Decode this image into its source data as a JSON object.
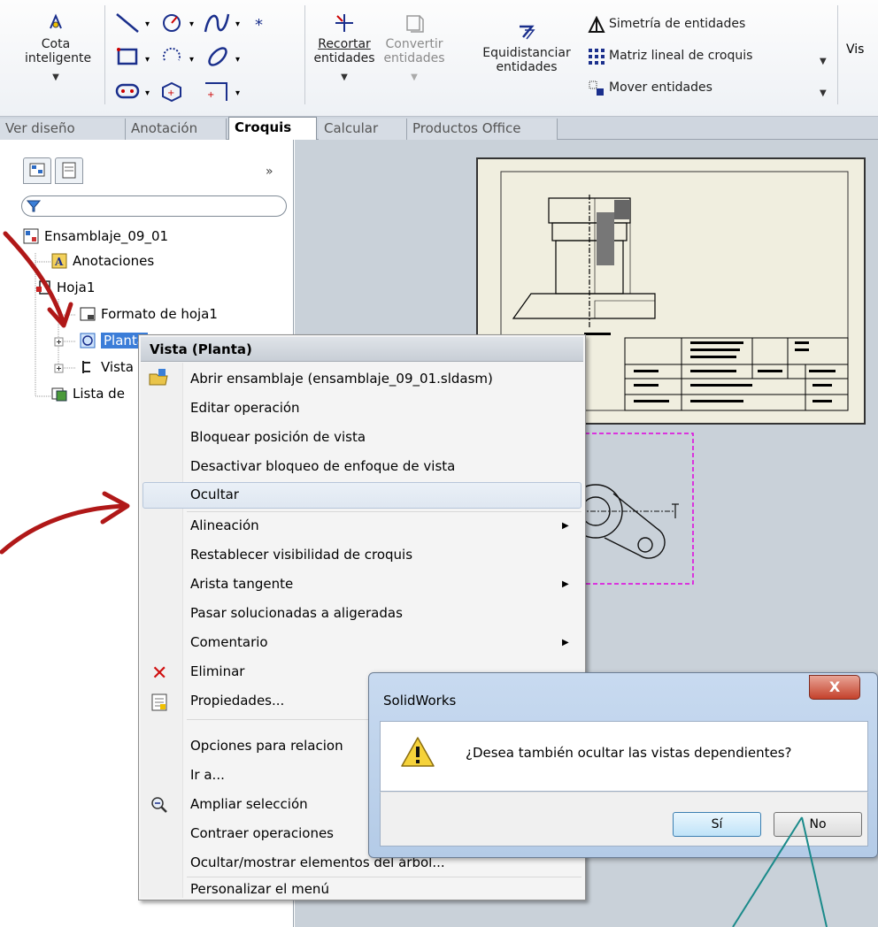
{
  "ribbon": {
    "cota_inteligente": [
      "Cota",
      "inteligente"
    ],
    "recortar": [
      "Recortar",
      "entidades"
    ],
    "convertir": [
      "Convertir",
      "entidades"
    ],
    "equidistanciar": [
      "Equidistanciar",
      "entidades"
    ],
    "simetria": "Simetría de entidades",
    "matriz": "Matriz lineal de croquis",
    "mover": "Mover entidades",
    "vis_partial": "Vis"
  },
  "tabs": [
    "Ver diseño",
    "Anotación",
    "Croquis",
    "Calcular",
    "Productos Office"
  ],
  "tree": {
    "root": "Ensamblaje_09_01",
    "anotaciones": "Anotaciones",
    "hoja": "Hoja1",
    "formato": "Formato de hoja1",
    "planta": "Planta",
    "vista": "Vista",
    "lista": "Lista de"
  },
  "context_menu": {
    "title": "Vista (Planta)",
    "items": [
      "Abrir ensamblaje (ensamblaje_09_01.sldasm)",
      "Editar operación",
      "Bloquear posición de vista",
      "Desactivar bloqueo de enfoque de vista",
      "Ocultar",
      "Alineación",
      "Restablecer visibilidad de croquis",
      "Arista tangente",
      "Pasar solucionadas a aligeradas",
      "Comentario",
      "Eliminar",
      "Propiedades...",
      "Opciones para relacion",
      "Ir a...",
      "Ampliar selección",
      "Contraer operaciones",
      "Ocultar/mostrar elementos del árbol...",
      "Personalizar el menú"
    ]
  },
  "dialog": {
    "title": "SolidWorks",
    "close": "X",
    "message": "¿Desea también ocultar las vistas dependientes?",
    "yes": "Sí",
    "no": "No"
  },
  "colors": {
    "annotation_red": "#b01818",
    "annotation_teal": "#1a8a8a",
    "selection_blue": "#3b7dd8",
    "view_box_magenta": "#e000e0"
  }
}
